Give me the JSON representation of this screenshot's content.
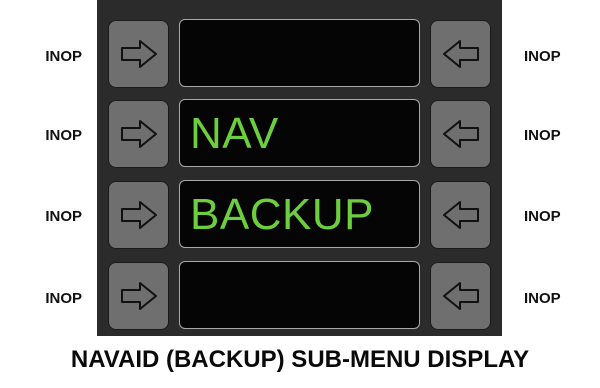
{
  "side_labels": {
    "left": [
      "INOP",
      "INOP",
      "INOP",
      "INOP"
    ],
    "right": [
      "INOP",
      "INOP",
      "INOP",
      "INOP"
    ]
  },
  "display_lines": [
    "",
    "NAV",
    "BACKUP",
    ""
  ],
  "left_keys_icon": "arrow-right-icon",
  "right_keys_icon": "arrow-left-icon",
  "caption": "NAVAID (BACKUP) SUB-MENU DISPLAY",
  "colors": {
    "panel": "#2b2b2b",
    "key": "#6f6f6f",
    "screen": "#050505",
    "screen_text": "#6ccf3d"
  }
}
